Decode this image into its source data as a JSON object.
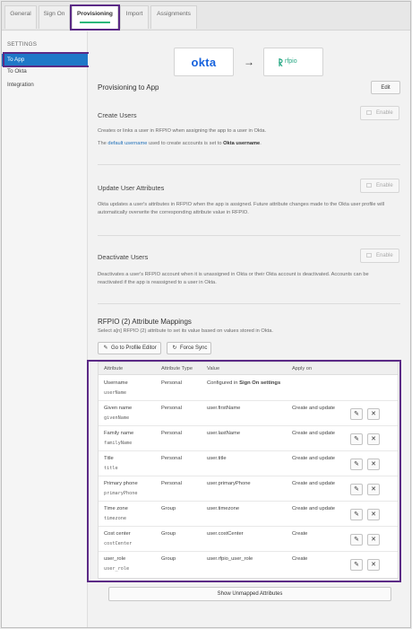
{
  "tabs": [
    {
      "label": "General",
      "active": false
    },
    {
      "label": "Sign On",
      "active": false
    },
    {
      "label": "Provisioning",
      "active": true
    },
    {
      "label": "Import",
      "active": false
    },
    {
      "label": "Assignments",
      "active": false
    }
  ],
  "sidebar": {
    "heading": "SETTINGS",
    "items": [
      {
        "label": "To App",
        "active": true
      },
      {
        "label": "To Okta",
        "active": false
      },
      {
        "label": "Integration",
        "active": false
      }
    ]
  },
  "logos": {
    "left": "okta",
    "right": "rfpio",
    "arrow": "→"
  },
  "provisioning": {
    "title": "Provisioning to App",
    "edit_label": "Edit"
  },
  "create_users": {
    "title": "Create Users",
    "button": "Enable",
    "desc1": "Creates or links a user in RFPIO when assigning the app to a user in Okta.",
    "desc2_prefix": "The",
    "desc2_link": "default username",
    "desc2_mid": "used to create accounts is set to",
    "desc2_bold": "Okta username",
    "desc2_end": "."
  },
  "update_users": {
    "title": "Update User Attributes",
    "button": "Enable",
    "desc": "Okta updates a user's attributes in RFPIO when the app is assigned. Future attribute changes made to the Okta user profile will automatically overwrite the corresponding attribute value in RFPIO."
  },
  "deactivate_users": {
    "title": "Deactivate Users",
    "button": "Enable",
    "desc": "Deactivates a user's RFPIO account when it is unassigned in Okta or their Okta account is deactivated. Accounts can be reactivated if the app is reassigned to a user in Okta."
  },
  "mappings": {
    "title": "RFPIO (2) Attribute Mappings",
    "desc": "Select a[n] RFPIO (2) attribute to set its value based on values stored in Okta.",
    "profile_editor": "Go to Profile Editor",
    "force_sync": "Force Sync",
    "columns": [
      "Attribute",
      "Attribute Type",
      "Value",
      "Apply on"
    ],
    "rows": [
      {
        "label": "Username",
        "var": "userName",
        "type": "Personal",
        "value_prefix": "Configured in",
        "value_bold": "Sign On settings",
        "apply": "",
        "editable": false
      },
      {
        "label": "Given name",
        "var": "givenName",
        "type": "Personal",
        "value": "user.firstName",
        "apply": "Create and update",
        "editable": true
      },
      {
        "label": "Family name",
        "var": "familyName",
        "type": "Personal",
        "value": "user.lastName",
        "apply": "Create and update",
        "editable": true
      },
      {
        "label": "Title",
        "var": "title",
        "type": "Personal",
        "value": "user.title",
        "apply": "Create and update",
        "editable": true
      },
      {
        "label": "Primary phone",
        "var": "primaryPhone",
        "type": "Personal",
        "value": "user.primaryPhone",
        "apply": "Create and update",
        "editable": true
      },
      {
        "label": "Time zone",
        "var": "timezone",
        "type": "Group",
        "value": "user.timezone",
        "apply": "Create and update",
        "editable": true
      },
      {
        "label": "Cost center",
        "var": "costCenter",
        "type": "Group",
        "value": "user.costCenter",
        "apply": "Create",
        "editable": true
      },
      {
        "label": "user_role",
        "var": "user_role",
        "type": "Group",
        "value": "user.rfpio_user_role",
        "apply": "Create",
        "editable": true
      }
    ],
    "show_unmapped": "Show Unmapped Attributes"
  },
  "icons": {
    "edit": "pencil-icon",
    "delete": "close-icon",
    "profile": "edit-icon",
    "sync": "refresh-icon"
  }
}
